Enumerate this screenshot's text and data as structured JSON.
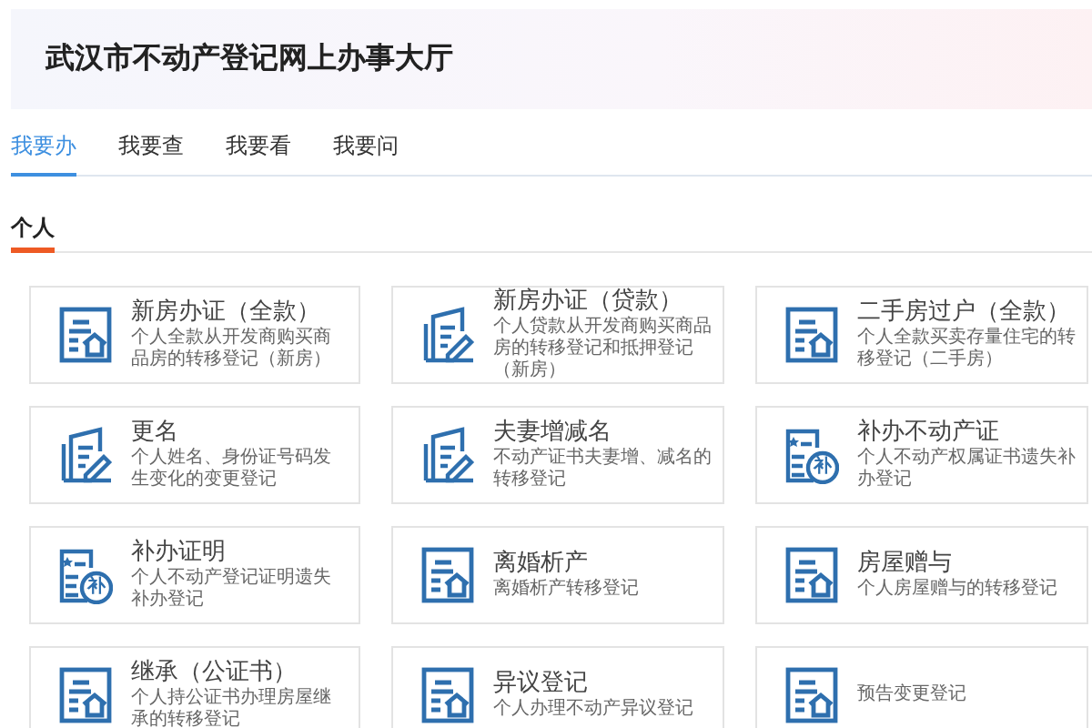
{
  "header": {
    "title": "武汉市不动产登记网上办事大厅"
  },
  "tabs": [
    {
      "label": "我要办",
      "selected": true
    },
    {
      "label": "我要查",
      "selected": false
    },
    {
      "label": "我要看",
      "selected": false
    },
    {
      "label": "我要问",
      "selected": false
    }
  ],
  "section": {
    "title": "个人"
  },
  "services": [
    {
      "kind": "document",
      "title": "新房办证（全款）",
      "description": "个人全款从开发商购买商品房的转移登记（新房）"
    },
    {
      "kind": "signing",
      "title": "新房办证（贷款）",
      "description": "个人贷款从开发商购买商品房的转移登记和抵押登记（新房）"
    },
    {
      "kind": "document",
      "title": "二手房过户（全款）",
      "description": "个人全款买卖存量住宅的转移登记（二手房）"
    },
    {
      "kind": "signing",
      "title": "更名",
      "description": "个人姓名、身份证号码发生变化的变更登记"
    },
    {
      "kind": "signing",
      "title": "夫妻增减名",
      "description": "不动产证书夫妻增、减名的转移登记"
    },
    {
      "kind": "certificate",
      "icon_text": "补",
      "title": "补办不动产证",
      "description": "个人不动产权属证书遗失补办登记"
    },
    {
      "kind": "certificate",
      "icon_text": "补",
      "title": "补办证明",
      "description": "个人不动产登记证明遗失补办登记"
    },
    {
      "kind": "document",
      "title": "离婚析产",
      "description": "离婚析产转移登记"
    },
    {
      "kind": "document",
      "title": "房屋赠与",
      "description": "个人房屋赠与的转移登记"
    },
    {
      "kind": "document",
      "title": "继承（公证书）",
      "description": "个人持公证书办理房屋继承的转移登记"
    },
    {
      "kind": "document",
      "title": "异议登记",
      "description": "个人办理不动产异议登记"
    },
    {
      "kind": "document",
      "description": "预告变更登记"
    }
  ]
}
